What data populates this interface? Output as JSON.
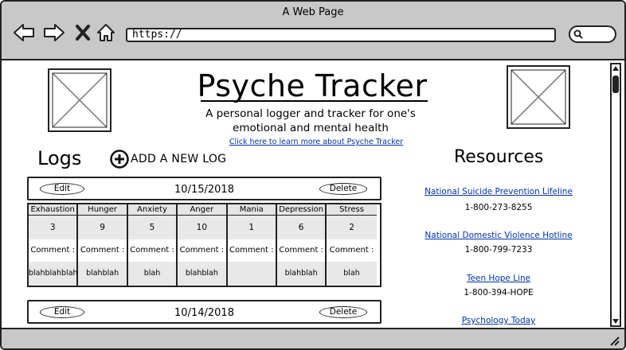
{
  "window": {
    "title": "A Web Page"
  },
  "address_bar": {
    "url": "https://"
  },
  "page": {
    "title": "Psyche Tracker",
    "subtitle_line1": "A personal logger and tracker for one's",
    "subtitle_line2": "emotional and mental health",
    "learn_more_link": "Click here to learn more about Psyche Tracker"
  },
  "logs": {
    "heading": "Logs",
    "add_label": "ADD A NEW LOG",
    "edit_label": "Edit",
    "delete_label": "Delete",
    "comment_label": "Comment :",
    "columns": [
      "Exhaustion",
      "Hunger",
      "Anxiety",
      "Anger",
      "Mania",
      "Depression",
      "Stress"
    ],
    "entries": [
      {
        "date": "10/15/2018",
        "values": [
          "3",
          "9",
          "5",
          "10",
          "1",
          "6",
          "2"
        ],
        "comments": [
          "blahblahblah",
          "blahblah",
          "blah",
          "blahblah",
          "",
          "blahblah",
          "blah"
        ]
      },
      {
        "date": "10/14/2018"
      }
    ]
  },
  "resources": {
    "heading": "Resources",
    "items": [
      {
        "name": "National Suicide Prevention Lifeline",
        "phone": "1-800-273-8255"
      },
      {
        "name": "National Domestic Violence Hotline",
        "phone": "1-800-799-7233"
      },
      {
        "name": "Teen Hope Line",
        "phone": "1-800-394-HOPE"
      },
      {
        "name": "Psychology Today"
      }
    ]
  }
}
